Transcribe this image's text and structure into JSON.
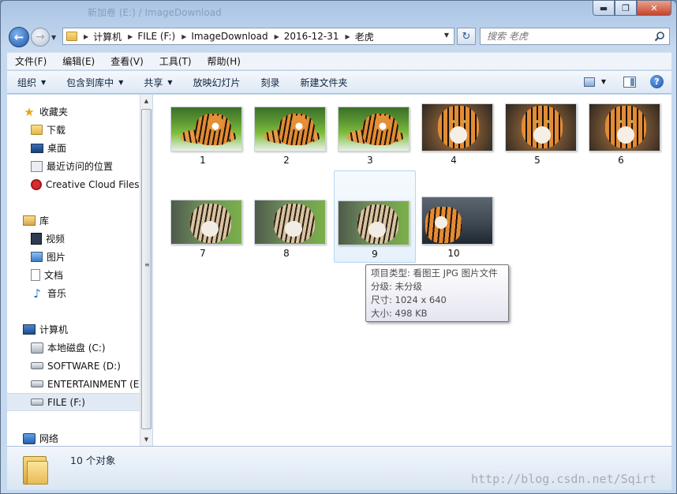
{
  "window": {
    "title_ghost": "新加卷 (E:) / ImageDownload",
    "controls": {
      "minimize": "▬",
      "maximize": "❐",
      "close": "✕"
    }
  },
  "address": {
    "breadcrumbs": [
      "计算机",
      "FILE (F:)",
      "ImageDownload",
      "2016-12-31",
      "老虎"
    ]
  },
  "search": {
    "placeholder": "搜索 老虎"
  },
  "menu": [
    "文件(F)",
    "编辑(E)",
    "查看(V)",
    "工具(T)",
    "帮助(H)"
  ],
  "toolbar": {
    "organize": "组织",
    "include_in_library": "包含到库中",
    "share": "共享",
    "slideshow": "放映幻灯片",
    "burn": "刻录",
    "new_folder": "新建文件夹"
  },
  "nav": {
    "favorites": {
      "label": "收藏夹",
      "items": [
        "下载",
        "桌面",
        "最近访问的位置",
        "Creative Cloud Files"
      ]
    },
    "libraries": {
      "label": "库",
      "items": [
        "视频",
        "图片",
        "文档",
        "音乐"
      ]
    },
    "computer": {
      "label": "计算机",
      "items": [
        "本地磁盘 (C:)",
        "SOFTWARE (D:)",
        "ENTERTAINMENT (E:)",
        "FILE (F:)"
      ],
      "selected": "FILE (F:)"
    },
    "network": {
      "label": "网络"
    }
  },
  "files": [
    {
      "name": "1",
      "art": "a"
    },
    {
      "name": "2",
      "art": "a"
    },
    {
      "name": "3",
      "art": "a"
    },
    {
      "name": "4",
      "art": "b"
    },
    {
      "name": "5",
      "art": "b"
    },
    {
      "name": "6",
      "art": "b"
    },
    {
      "name": "7",
      "art": "c"
    },
    {
      "name": "8",
      "art": "c"
    },
    {
      "name": "9",
      "art": "c",
      "selected": true
    },
    {
      "name": "10",
      "art": "d"
    }
  ],
  "tooltip": {
    "type": "项目类型: 看图王 JPG 图片文件",
    "rating": "分级: 未分级",
    "dimensions": "尺寸: 1024 x 640",
    "size": "大小: 498 KB"
  },
  "status": {
    "count": "10 个对象"
  },
  "watermark": "http://blog.csdn.net/Sqirt"
}
